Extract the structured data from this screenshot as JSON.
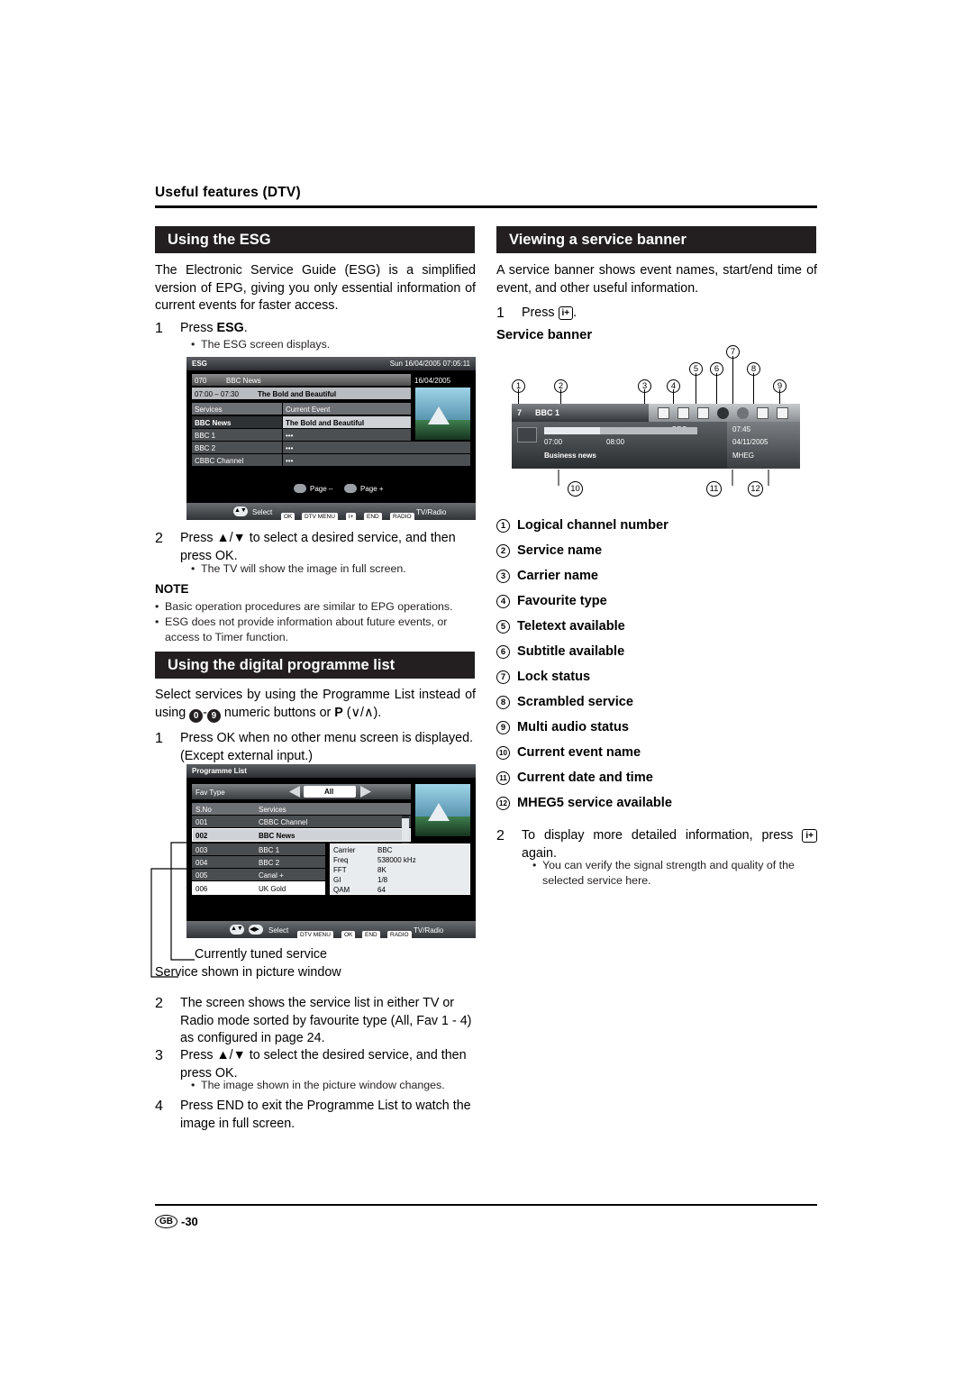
{
  "header": {
    "title": "Useful features (DTV)"
  },
  "left": {
    "section1_title": "Using the ESG",
    "intro": "The Electronic Service Guide (ESG) is a simplified version of EPG, giving you only essential information of current events for faster access.",
    "step1_num": "1",
    "step1_text_pre": "Press ",
    "step1_text_bold": "ESG",
    "step1_text_post": ".",
    "step1_bullet": "The ESG screen displays.",
    "step2_num": "2",
    "step2_text": "Press ▲/▼ to select a desired service, and then press OK.",
    "step2_bullet": "The TV will show the image in full screen.",
    "note_title": "NOTE",
    "note1": "Basic operation procedures are similar to EPG operations.",
    "note2": "ESG does not provide information about future events, or access to Timer function.",
    "section2_title": "Using the digital programme list",
    "intro2_a": "Select services by using the Programme List instead of using ",
    "intro2_key0": "0",
    "intro2_dash": "-",
    "intro2_key9": "9",
    "intro2_b": " numeric buttons or ",
    "intro2_p": "P",
    "intro2_c": " (∨/∧).",
    "pl_step1_num": "1",
    "pl_step1_text": "Press OK when no other menu screen is displayed. (Except external input.)",
    "caption1": "Currently tuned service",
    "caption2": "Service shown in picture window",
    "pl_step2_num": "2",
    "pl_step2_text": "The screen shows the service list in either TV or Radio mode sorted by favourite type (All, Fav 1 - 4) as configured in page 24.",
    "pl_step3_num": "3",
    "pl_step3_text": "Press ▲/▼ to select the desired service, and then press OK.",
    "pl_step3_bullet": "The image shown in the picture window changes.",
    "pl_step4_num": "4",
    "pl_step4_text": "Press END to exit the Programme List to watch the image in full screen."
  },
  "right": {
    "section_title": "Viewing a service banner",
    "intro": "A service banner shows event names, start/end time of event, and other useful information.",
    "step1_num": "1",
    "step1_text_pre": "Press ",
    "step1_key": "i+",
    "step1_text_post": ".",
    "banner_label": "Service banner",
    "legend": [
      {
        "n": "1",
        "label": "Logical channel number"
      },
      {
        "n": "2",
        "label": "Service name"
      },
      {
        "n": "3",
        "label": "Carrier name"
      },
      {
        "n": "4",
        "label": "Favourite type"
      },
      {
        "n": "5",
        "label": "Teletext available"
      },
      {
        "n": "6",
        "label": "Subtitle available"
      },
      {
        "n": "7",
        "label": "Lock status"
      },
      {
        "n": "8",
        "label": "Scrambled service"
      },
      {
        "n": "9",
        "label": "Multi audio status"
      },
      {
        "n": "10",
        "label": "Current event name"
      },
      {
        "n": "11",
        "label": "Current date and time"
      },
      {
        "n": "12",
        "label": "MHEG5 service available"
      }
    ],
    "step2_num": "2",
    "step2_text_pre": "To display more detailed information, press ",
    "step2_key": "i+",
    "step2_text_post": " again.",
    "step2_bullet": "You can verify the signal strength and quality of the selected service here."
  },
  "esg_screen": {
    "title": "ESG",
    "datetime": "Sun 16/04/2005 07:05:11",
    "channel_num": "070",
    "channel_name": "BBC News",
    "date": "16/04/2005",
    "time_range": "07:00 – 07:30",
    "programme": "The Bold and Beautiful",
    "col1": "Services",
    "col2": "Current Event",
    "rows": [
      {
        "service": "BBC News",
        "event": "The Bold and Beautiful"
      },
      {
        "service": "BBC 1",
        "event": "•••"
      },
      {
        "service": "BBC 2",
        "event": "•••"
      },
      {
        "service": "CBBC Channel",
        "event": "•••"
      }
    ],
    "page_prev": "Page –",
    "page_next": "Page +",
    "keys": [
      "Select",
      "OK",
      "DTV MENU",
      "i+",
      "END",
      "RADIO",
      "TV/Radio"
    ]
  },
  "programme_list": {
    "title": "Programme List",
    "fav_type_label": "Fav Type",
    "fav_type_value": "All",
    "col_no": "S.No",
    "col_services": "Services",
    "rows": [
      {
        "no": "001",
        "name": "CBBC Channel"
      },
      {
        "no": "002",
        "name": "BBC News"
      },
      {
        "no": "003",
        "name": "BBC 1"
      },
      {
        "no": "004",
        "name": "BBC 2"
      },
      {
        "no": "005",
        "name": "Canal +"
      },
      {
        "no": "006",
        "name": "UK Gold"
      }
    ],
    "info": [
      {
        "k": "Carrier",
        "v": "BBC"
      },
      {
        "k": "Freq",
        "v": "538000 kHz"
      },
      {
        "k": "FFT",
        "v": "8K"
      },
      {
        "k": "GI",
        "v": "1/8"
      },
      {
        "k": "QAM",
        "v": "64"
      }
    ],
    "keys": [
      "Select",
      "DTV MENU",
      "OK",
      "END",
      "RADIO",
      "TV/Radio"
    ]
  },
  "service_banner": {
    "channel_num": "7",
    "service_name": "BBC 1",
    "carrier": "BBC",
    "time_start": "07:00",
    "time_end": "08:00",
    "event": "Business news",
    "clock": "07:45",
    "date": "04/11/2005",
    "mheg": "MHEG",
    "callouts_top": [
      "1",
      "2",
      "3",
      "4",
      "5",
      "6",
      "7",
      "8",
      "9"
    ],
    "callouts_bottom": [
      "10",
      "11",
      "12"
    ]
  },
  "footer": {
    "gb": "GB",
    "page": "-30"
  }
}
